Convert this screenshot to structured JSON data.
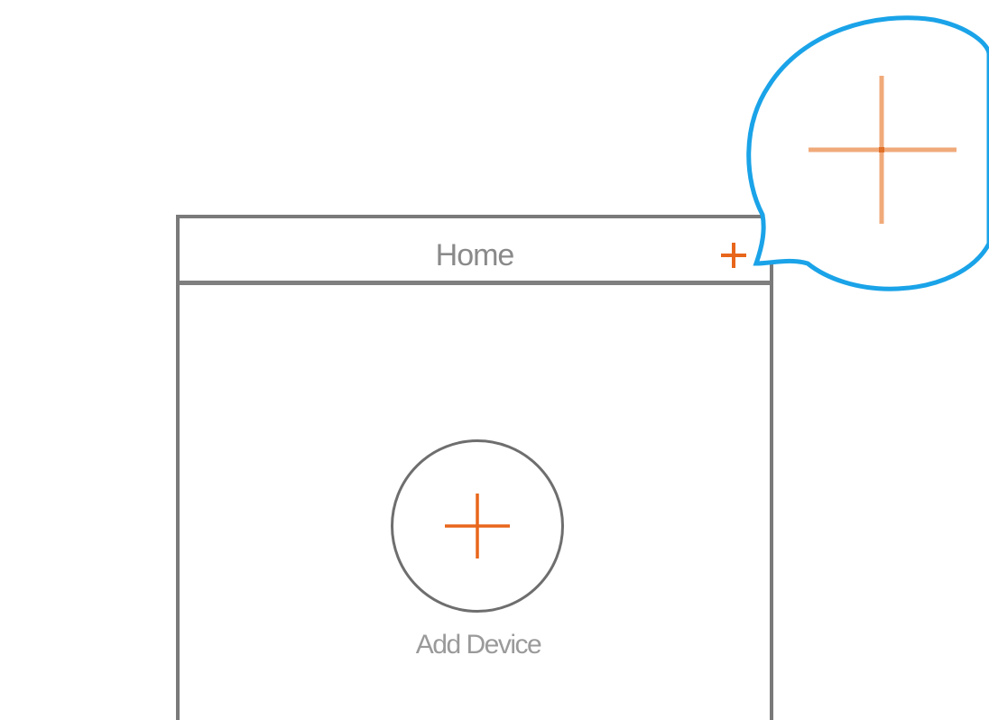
{
  "header": {
    "title": "Home",
    "add_icon": "plus-icon"
  },
  "main": {
    "add_device_label": "Add Device",
    "add_device_icon": "plus-icon"
  },
  "callout": {
    "icon": "plus-icon",
    "highlight_color": "#1aa3e8"
  },
  "colors": {
    "accent": "#e8661b",
    "frame": "#7a7a7a"
  }
}
